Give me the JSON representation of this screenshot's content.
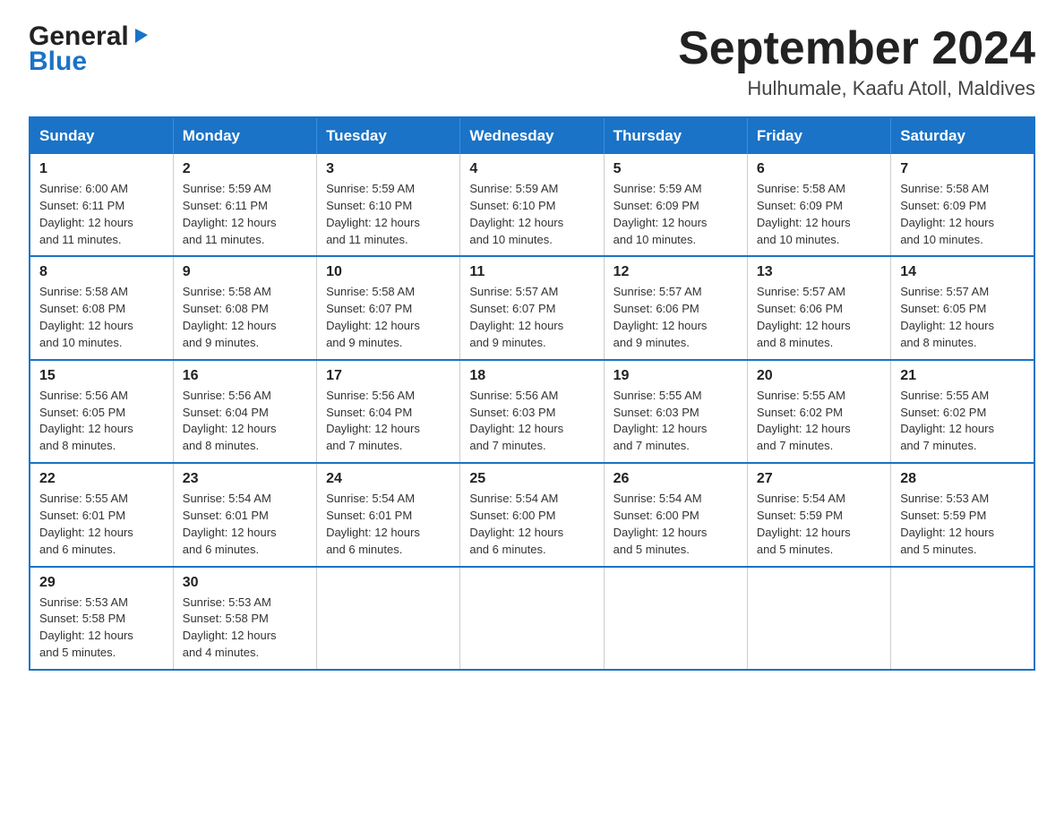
{
  "logo": {
    "general": "General",
    "blue": "Blue",
    "arrow": "▶"
  },
  "title": "September 2024",
  "subtitle": "Hulhumale, Kaafu Atoll, Maldives",
  "days_of_week": [
    "Sunday",
    "Monday",
    "Tuesday",
    "Wednesday",
    "Thursday",
    "Friday",
    "Saturday"
  ],
  "weeks": [
    [
      {
        "day": "1",
        "sunrise": "6:00 AM",
        "sunset": "6:11 PM",
        "daylight": "12 hours and 11 minutes."
      },
      {
        "day": "2",
        "sunrise": "5:59 AM",
        "sunset": "6:11 PM",
        "daylight": "12 hours and 11 minutes."
      },
      {
        "day": "3",
        "sunrise": "5:59 AM",
        "sunset": "6:10 PM",
        "daylight": "12 hours and 11 minutes."
      },
      {
        "day": "4",
        "sunrise": "5:59 AM",
        "sunset": "6:10 PM",
        "daylight": "12 hours and 10 minutes."
      },
      {
        "day": "5",
        "sunrise": "5:59 AM",
        "sunset": "6:09 PM",
        "daylight": "12 hours and 10 minutes."
      },
      {
        "day": "6",
        "sunrise": "5:58 AM",
        "sunset": "6:09 PM",
        "daylight": "12 hours and 10 minutes."
      },
      {
        "day": "7",
        "sunrise": "5:58 AM",
        "sunset": "6:09 PM",
        "daylight": "12 hours and 10 minutes."
      }
    ],
    [
      {
        "day": "8",
        "sunrise": "5:58 AM",
        "sunset": "6:08 PM",
        "daylight": "12 hours and 10 minutes."
      },
      {
        "day": "9",
        "sunrise": "5:58 AM",
        "sunset": "6:08 PM",
        "daylight": "12 hours and 9 minutes."
      },
      {
        "day": "10",
        "sunrise": "5:58 AM",
        "sunset": "6:07 PM",
        "daylight": "12 hours and 9 minutes."
      },
      {
        "day": "11",
        "sunrise": "5:57 AM",
        "sunset": "6:07 PM",
        "daylight": "12 hours and 9 minutes."
      },
      {
        "day": "12",
        "sunrise": "5:57 AM",
        "sunset": "6:06 PM",
        "daylight": "12 hours and 9 minutes."
      },
      {
        "day": "13",
        "sunrise": "5:57 AM",
        "sunset": "6:06 PM",
        "daylight": "12 hours and 8 minutes."
      },
      {
        "day": "14",
        "sunrise": "5:57 AM",
        "sunset": "6:05 PM",
        "daylight": "12 hours and 8 minutes."
      }
    ],
    [
      {
        "day": "15",
        "sunrise": "5:56 AM",
        "sunset": "6:05 PM",
        "daylight": "12 hours and 8 minutes."
      },
      {
        "day": "16",
        "sunrise": "5:56 AM",
        "sunset": "6:04 PM",
        "daylight": "12 hours and 8 minutes."
      },
      {
        "day": "17",
        "sunrise": "5:56 AM",
        "sunset": "6:04 PM",
        "daylight": "12 hours and 7 minutes."
      },
      {
        "day": "18",
        "sunrise": "5:56 AM",
        "sunset": "6:03 PM",
        "daylight": "12 hours and 7 minutes."
      },
      {
        "day": "19",
        "sunrise": "5:55 AM",
        "sunset": "6:03 PM",
        "daylight": "12 hours and 7 minutes."
      },
      {
        "day": "20",
        "sunrise": "5:55 AM",
        "sunset": "6:02 PM",
        "daylight": "12 hours and 7 minutes."
      },
      {
        "day": "21",
        "sunrise": "5:55 AM",
        "sunset": "6:02 PM",
        "daylight": "12 hours and 7 minutes."
      }
    ],
    [
      {
        "day": "22",
        "sunrise": "5:55 AM",
        "sunset": "6:01 PM",
        "daylight": "12 hours and 6 minutes."
      },
      {
        "day": "23",
        "sunrise": "5:54 AM",
        "sunset": "6:01 PM",
        "daylight": "12 hours and 6 minutes."
      },
      {
        "day": "24",
        "sunrise": "5:54 AM",
        "sunset": "6:01 PM",
        "daylight": "12 hours and 6 minutes."
      },
      {
        "day": "25",
        "sunrise": "5:54 AM",
        "sunset": "6:00 PM",
        "daylight": "12 hours and 6 minutes."
      },
      {
        "day": "26",
        "sunrise": "5:54 AM",
        "sunset": "6:00 PM",
        "daylight": "12 hours and 5 minutes."
      },
      {
        "day": "27",
        "sunrise": "5:54 AM",
        "sunset": "5:59 PM",
        "daylight": "12 hours and 5 minutes."
      },
      {
        "day": "28",
        "sunrise": "5:53 AM",
        "sunset": "5:59 PM",
        "daylight": "12 hours and 5 minutes."
      }
    ],
    [
      {
        "day": "29",
        "sunrise": "5:53 AM",
        "sunset": "5:58 PM",
        "daylight": "12 hours and 5 minutes."
      },
      {
        "day": "30",
        "sunrise": "5:53 AM",
        "sunset": "5:58 PM",
        "daylight": "12 hours and 4 minutes."
      },
      null,
      null,
      null,
      null,
      null
    ]
  ]
}
